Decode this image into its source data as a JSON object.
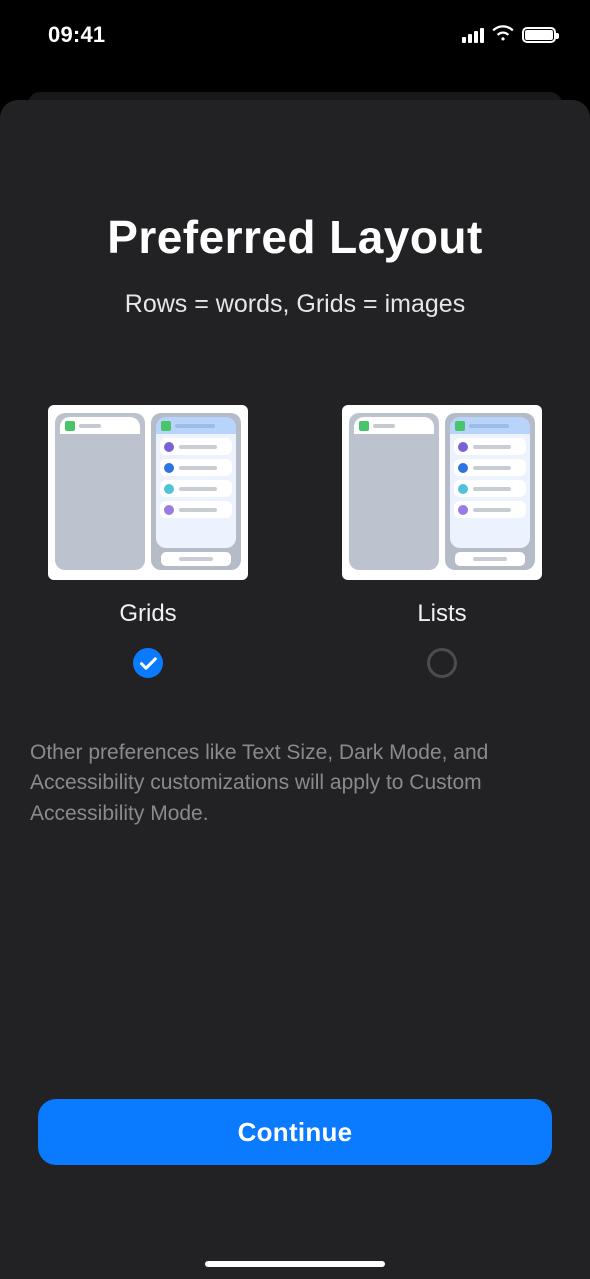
{
  "statusbar": {
    "time": "09:41"
  },
  "page": {
    "title": "Preferred Layout",
    "subtitle": "Rows = words, Grids = images",
    "note": "Other preferences like Text Size, Dark Mode, and Accessibility customizations will apply to Custom Accessibility Mode.",
    "cta": "Continue"
  },
  "options": [
    {
      "label": "Grids",
      "selected": true
    },
    {
      "label": "Lists",
      "selected": false
    }
  ]
}
